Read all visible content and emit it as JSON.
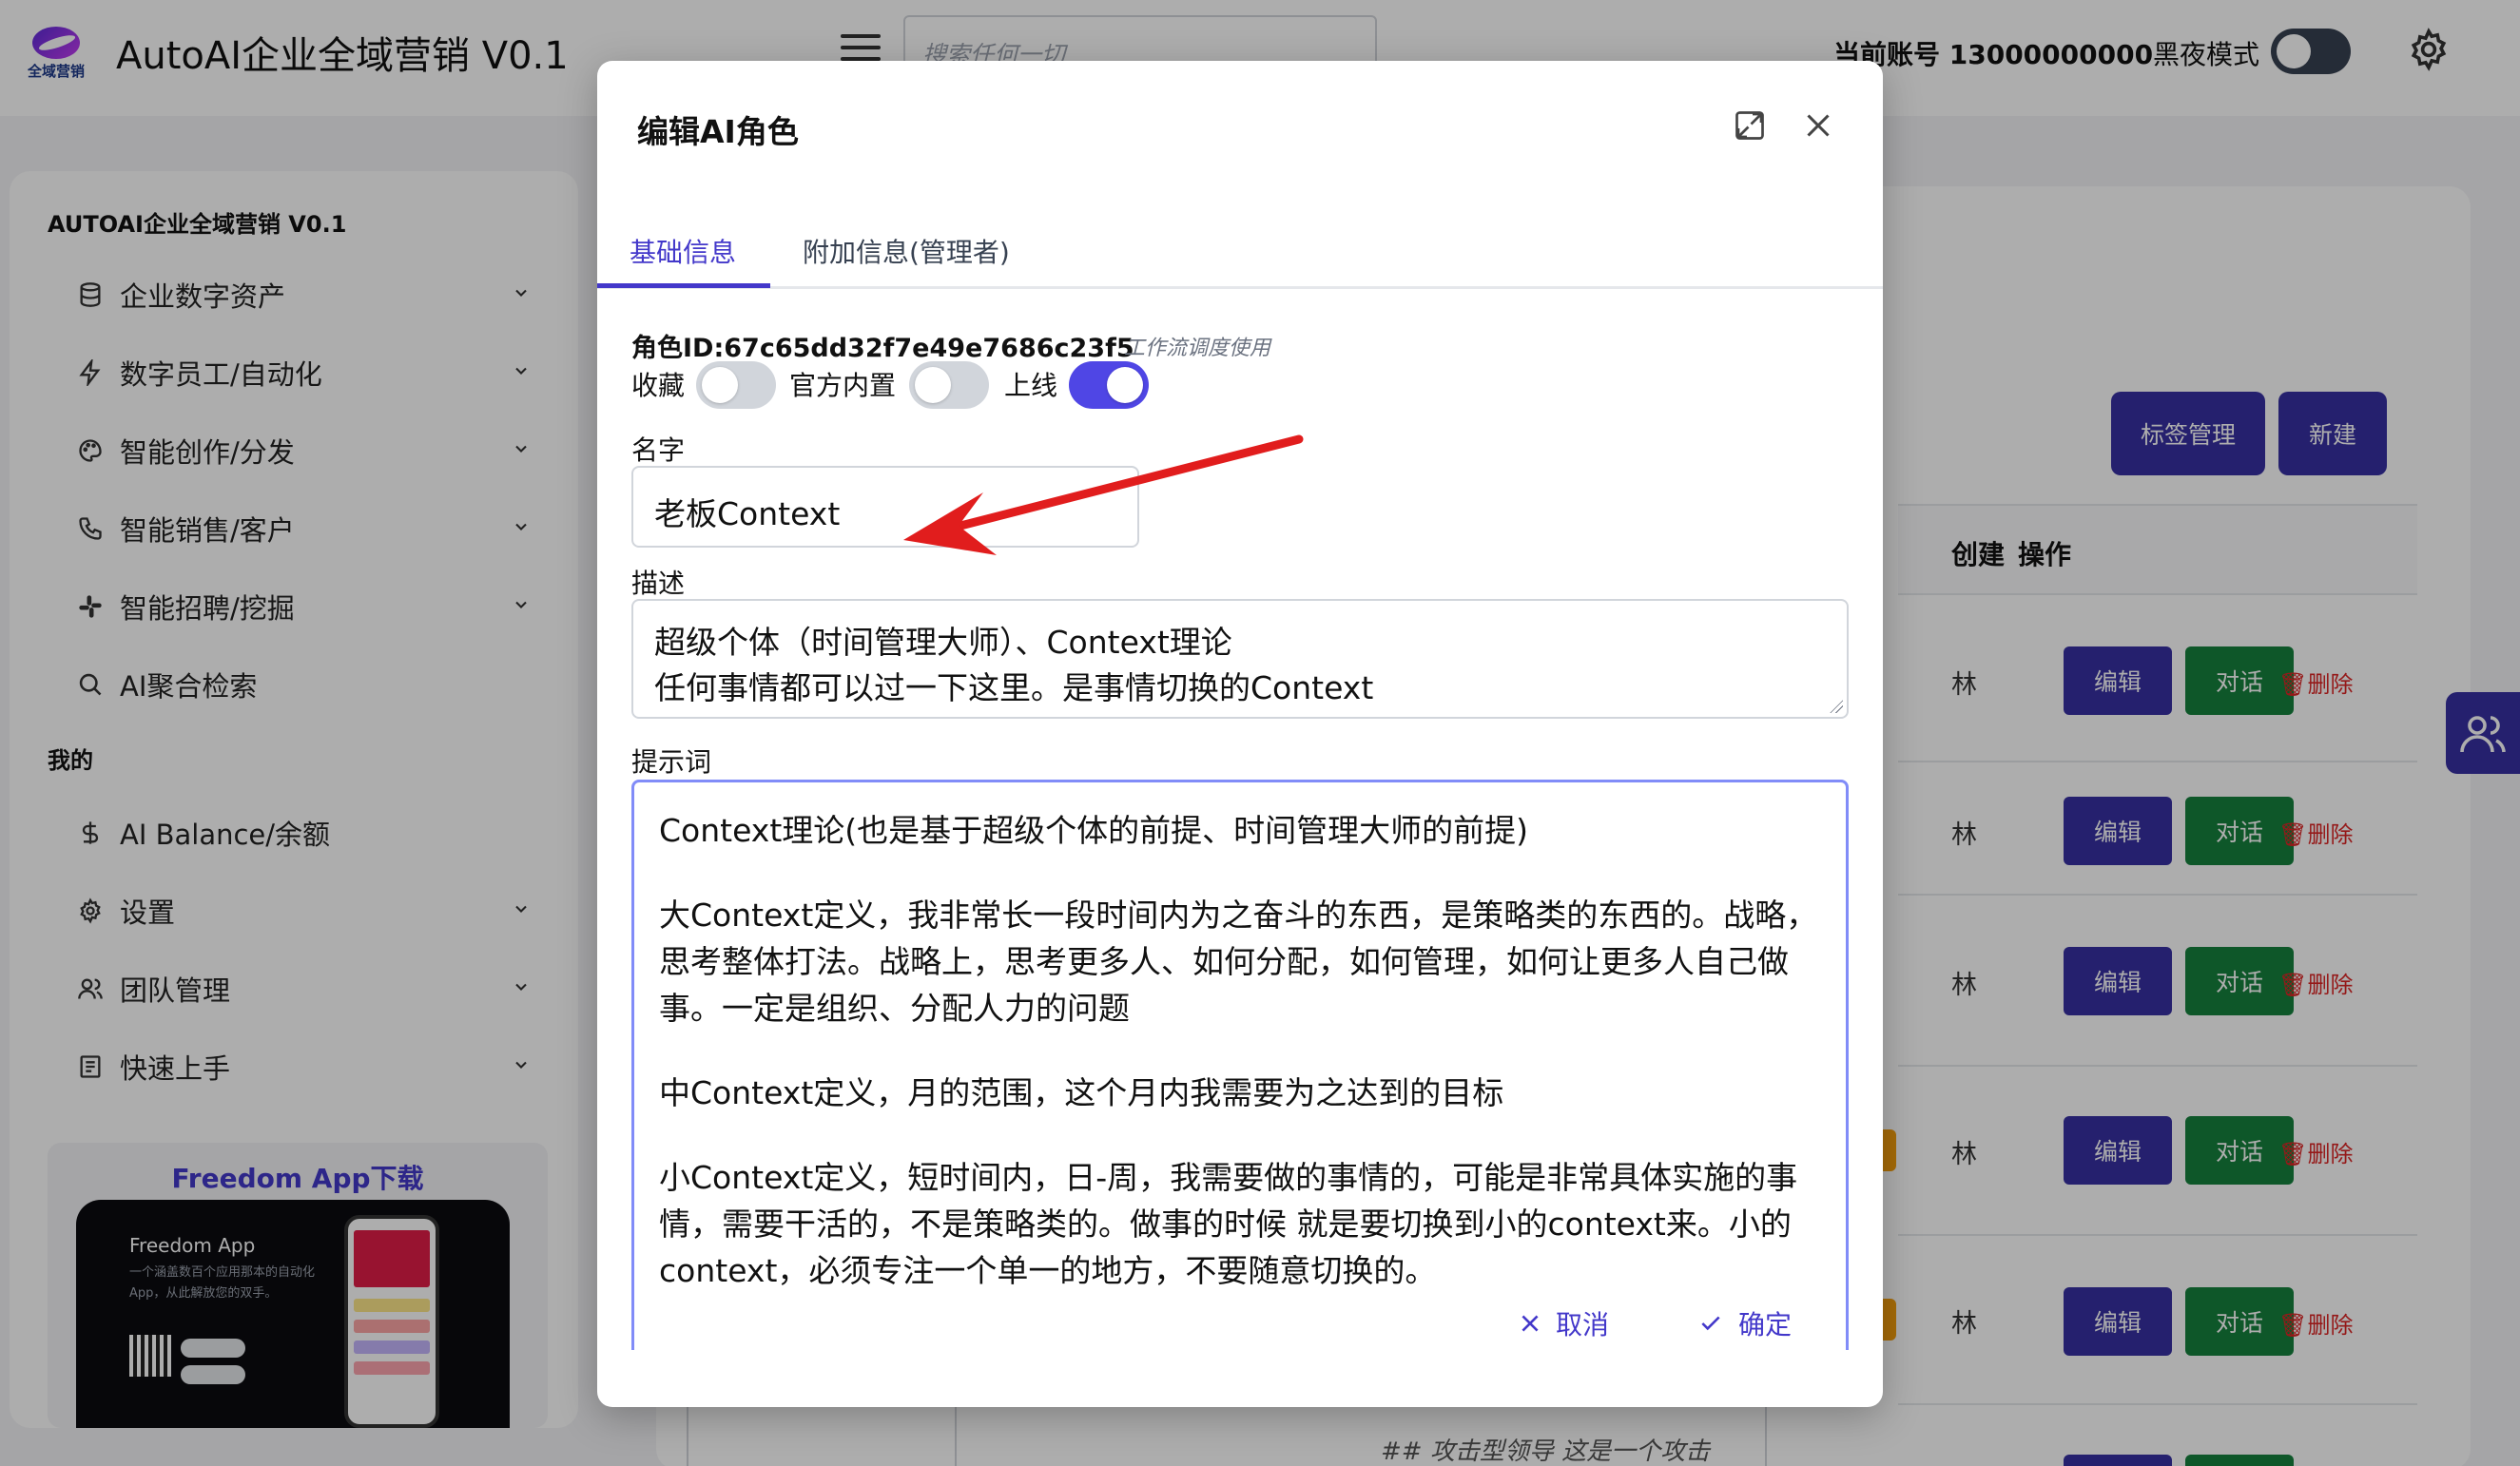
{
  "header": {
    "logo_text": "全域营销",
    "app_title": "AutoAI企业全域营销 V0.1",
    "search_placeholder": "搜索任何一切",
    "account": "当前账号 13000000000",
    "dark_mode_label": "黑夜模式"
  },
  "sidebar": {
    "title": "AUTOAI企业全域营销 V0.1",
    "items": [
      {
        "label": "企业数字资产",
        "icon": "database-icon"
      },
      {
        "label": "数字员工/自动化",
        "icon": "bolt-icon"
      },
      {
        "label": "智能创作/分发",
        "icon": "palette-icon"
      },
      {
        "label": "智能销售/客户",
        "icon": "phone-icon"
      },
      {
        "label": "智能招聘/挖掘",
        "icon": "slack-icon"
      },
      {
        "label": "AI聚合检索",
        "icon": "search-icon"
      }
    ],
    "section_mine": "我的",
    "mine_items": [
      {
        "label": "AI Balance/余额",
        "icon": "dollar-icon"
      },
      {
        "label": "设置",
        "icon": "gear-icon"
      },
      {
        "label": "团队管理",
        "icon": "users-icon"
      },
      {
        "label": "快速上手",
        "icon": "book-icon"
      }
    ],
    "promo": {
      "title": "Freedom App下载",
      "app_name": "Freedom App",
      "app_desc": "一个涵盖数百个应用那本的自动化App，从此解放您的双手。"
    }
  },
  "main": {
    "tag_button": "标签管理",
    "new_button": "新建",
    "columns": [
      "创建",
      "操作"
    ],
    "row_author": "林",
    "row_edit": "编辑",
    "row_chat": "对话",
    "row_delete": "删除",
    "bg_text": "## 攻击型领导 这是一个攻击"
  },
  "modal": {
    "title": "编辑AI角色",
    "tabs": [
      "基础信息",
      "附加信息(管理者)"
    ],
    "role_id_label": "角色ID:67c65dd32f7e49e7686c23f5",
    "role_id_note": "工作流调度使用",
    "switches": [
      {
        "label": "收藏",
        "on": false
      },
      {
        "label": "官方内置",
        "on": false
      },
      {
        "label": "上线",
        "on": true
      }
    ],
    "name_label": "名字",
    "name_value": "老板Context",
    "desc_label": "描述",
    "desc_lines": [
      "超级个体（时间管理大师）、Context理论",
      "任何事情都可以过一下这里。是事情切换的Context"
    ],
    "prompt_label": "提示词",
    "prompt_paragraphs": [
      "Context理论(也是基于超级个体的前提、时间管理大师的前提)",
      "大Context定义，我非常长一段时间内为之奋斗的东西，是策略类的东西的。战略，思考整体打法。战略上，思考更多人、如何分配，如何管理，如何让更多人自己做事。一定是组织、分配人力的问题",
      "中Context定义，月的范围，这个月内我需要为之达到的目标",
      "小Context定义，短时间内，日-周，我需要做的事情的，可能是非常具体实施的事情，需要干活的，不是策略类的。做事的时候 就是要切换到小的context来。小的context，必须专注一个单一的地方，不要随意切换的。"
    ],
    "cancel_label": "取消",
    "confirm_label": "确定"
  },
  "colors": {
    "accent": "#4338ca",
    "primary_button": "#3730a3",
    "chat_button": "#15803d",
    "delete_text": "#dc2626",
    "arrow": "#e11d1d"
  }
}
